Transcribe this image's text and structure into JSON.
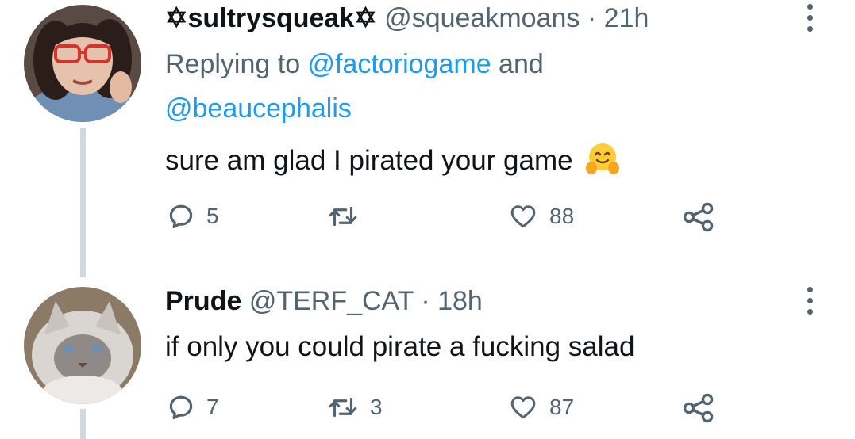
{
  "tweets": [
    {
      "avatar": "avatar-woman-red-glasses",
      "display_name": "✡sultrysqueak✡",
      "handle": "@squeakmoans",
      "separator": "·",
      "time": "21h",
      "replying_prefix": "Replying to ",
      "replying_mention_1": "@factoriogame",
      "replying_and": " and",
      "replying_mention_2": "@beaucephalis",
      "text": "sure am glad I pirated your game",
      "emoji": "hugging-face-emoji",
      "replies": "5",
      "retweets": "",
      "likes": "88"
    },
    {
      "avatar": "avatar-grey-cat",
      "display_name": "Prude",
      "handle": "@TERF_CAT",
      "separator": "·",
      "time": "18h",
      "text": "if only you could pirate a fucking salad",
      "replies": "7",
      "retweets": "3",
      "likes": "87"
    }
  ],
  "colors": {
    "text": "#0f1419",
    "secondary": "#536471",
    "mention": "#1d9bf0",
    "thread_line": "#cfd9de"
  }
}
